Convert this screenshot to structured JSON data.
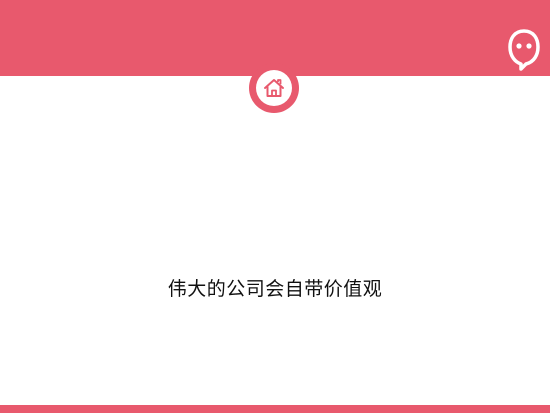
{
  "slide": {
    "headline": "伟大的公司会自带价值观"
  },
  "icons": {
    "home": "home-icon",
    "logo": "smiley-logo-icon"
  },
  "colors": {
    "accent": "#e8596d",
    "background": "#ffffff",
    "text": "#111111"
  }
}
